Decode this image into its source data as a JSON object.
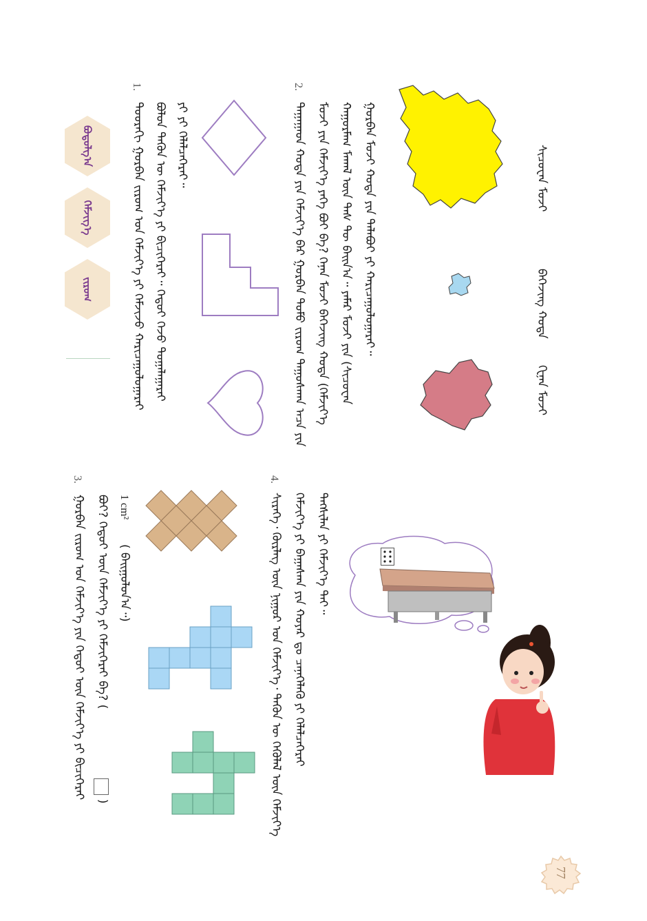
{
  "page_number": "77",
  "colors": {
    "accent": "#7a3a8e",
    "hex_fill": "#f5e6cf",
    "yellow_region": "#fff200",
    "blue_region": "#a8d8f0",
    "pink_region": "#d57c87",
    "tan_tile": "#d9b48a",
    "blue_tile": "#aad7f5",
    "green_tile": "#8fd3b6",
    "outline_shape": "#9d7cc1"
  },
  "map_labels": [
    "ᠰᠢᠴᠤᠸᠠᠨ ᠮᠤᠵᠢ",
    "ᠪᠡᠭᠡᠵᠢᠩ ᠬᠣᠲᠠ",
    "ᠬᠧᠨᠠᠨ ᠮᠤᠵᠢ"
  ],
  "sections": {
    "s2": {
      "number": "2.",
      "lines": [
        "ᠭᠤᠷᠪᠠᠨ ᠮᠤᠵᠢ ᠬᠣᠲᠠ ᠶᠢᠨ ᠲᠠᠯᠠᠪᠤᠢ ᠶᠢ ᠬᠠᠷᠢᠴᠠᠭᠤᠯᠤᠭᠠᠷᠠᠢ᠃",
        "ᠬᠠᠭᠤᠷᠮᠠᠭ ᠮᠠᠬᠠᠯ ᠦᠨ ᠳᠡᠰ ᠲᠦ ᠪᠠᠢᠨ᠎ᠠ᠃ ᠶᠠᠮᠠᠷ ᠮᠤᠵᠢ ᠶᠢᠨ (ᠰᠢᠴᠤᠸᠠᠨ",
        "ᠮᠤᠵᠢ ᠶᠢᠨ ᠬᠡᠮᠵᠢᠶ᠎ᠡ ᠶᠡᠬᠡ ᠪᠤᠢ ᠪᠡ? ᠬᠡᠨᠠᠨ ᠮᠤᠵᠢ ᠪᠡᠭᠡᠵᠢᠩ ᠬᠣᠲᠠ (ᠬᠡᠮᠵᠢᠶ᠎ᠡ",
        "ᠳᠠᠭᠠᠭᠠᠳ ᠬᠣᠲᠠ ᠶᠢᠨ ᠬᠡᠮᠵᠢᠶ᠎ᠡ ᠪᠡᠷ ᠭᠤᠷᠪᠠᠨ ᠲᠤᠮᠤ ᠵᠢᠷᠤᠭ ᠳᠠᠭᠤᠰᠭᠠᠨ ᠠᠴᠠ ᠶᠢᠨ"
      ]
    },
    "s1": {
      "number": "1.",
      "lines": [
        "ᠳᠣᠣᠷᠠᠬᠢ ᠭᠤᠷᠪᠠᠨ ᠵᠢᠷᠤᠭ ᠤᠨ ᠬᠡᠮᠵᠢᠶ᠎ᠡ ᠶᠢ ᠬᠡᠮᠵᠢᠵᠦ ᠬᠠᠷᠢᠴᠠᠭᠤᠯᠤᠭᠠᠷᠠᠢ",
        "ᠪᠤᠯᠤᠨ ᠲᠡᠭᠦᠨ ᠦ ᠬᠡᠮᠵᠢᠶ᠎ᠡ ᠶᠢ ᠪᠢᠴᠢᠭᠡᠷᠡᠢ᠃ ᠬᠡᠳᠦᠢ ᠭᠡᠵᠦ ᠲᠣᠭᠠᠯᠠᠭᠠᠷᠠᠢ",
        "ᠶᠢ ᠶᠢ ᠬᠡᠯᠡᠯᠴᠡᠭᠡᠷᠡᠢ᠃"
      ]
    },
    "s4": {
      "number": "4.",
      "lines": [
        "ᠬᠡᠮᠵᠢᠶ᠎ᠡ ᠶᠢ ᠪᠠᠭᠠᠰᠬᠠ ᠶᠢᠨ ᠬᠣᠶᠠᠷ ᠳᠤ ᠴᠡᠨᠡᠭᠡᠯᠡᠬᠦ ᠶᠢ ᠬᠡᠯᠡᠯᠴᠡᠭᠡᠷᠡᠢ",
        "ᠰᠢᠷᠡᠭᠡ᠂ ᠬᠦᠷᠯᠡᠭ ᠦᠨ ᠨᠢᠭᠤᠷ ᠤᠨ ᠬᠡᠮᠵᠢᠶ᠎ᠡ᠂ ᠲᠡᠭᠦᠨ ᠦ ᠬᠡᠭᠦᠯᠡᠯ ᠦᠨ ᠬᠡᠮᠵᠢᠶ᠎ᠡ",
        "ᠲᠡᠭᠰᠢᠯᠡᠨ ᠶᠢ ᠬᠡᠮᠵᠢᠶ᠎ᠡ ᠲᠠᠢ᠃"
      ]
    },
    "s3": {
      "number": "3.",
      "unit": "1 cm²",
      "unit_suffix": "( ᠪᠠᠢᠭᠤᠯᠤᠨ᠎ᠠ᠃)",
      "lines": [
        "ᠪᠤᠢ? ᠬᠡᠳᠦᠢ ᠦᠨ ᠬᠡᠮᠵᠢᠶ᠎ᠡ ᠶᠢ ᠬᠡᠮᠵᠢᠭᠡᠷᠡᠢ ᠪᠡ?  (",
        "ᠭᠤᠷᠪᠠᠨ ᠵᠢᠷᠤᠭ ᠤᠨ ᠬᠡᠮᠵᠢᠶ᠎ᠡ ᠶᠢᠨ ᠬᠡᠳᠦᠢ ᠦᠨ ᠬᠡᠮᠵᠢᠶ᠎ᠡ ᠶᠢ ᠪᠢᠴᠢᠭᠡᠷᠡᠢ"
      ],
      "box_suffix": ")"
    }
  },
  "hex_buttons": [
    "ᠪᠣᠳᠣᠯᠭ᠎ᠠ",
    "ᠬᠡᠮᠵᠢᠭ᠎ᠡ",
    "ᠵᠢᠷᠤᠭ"
  ]
}
